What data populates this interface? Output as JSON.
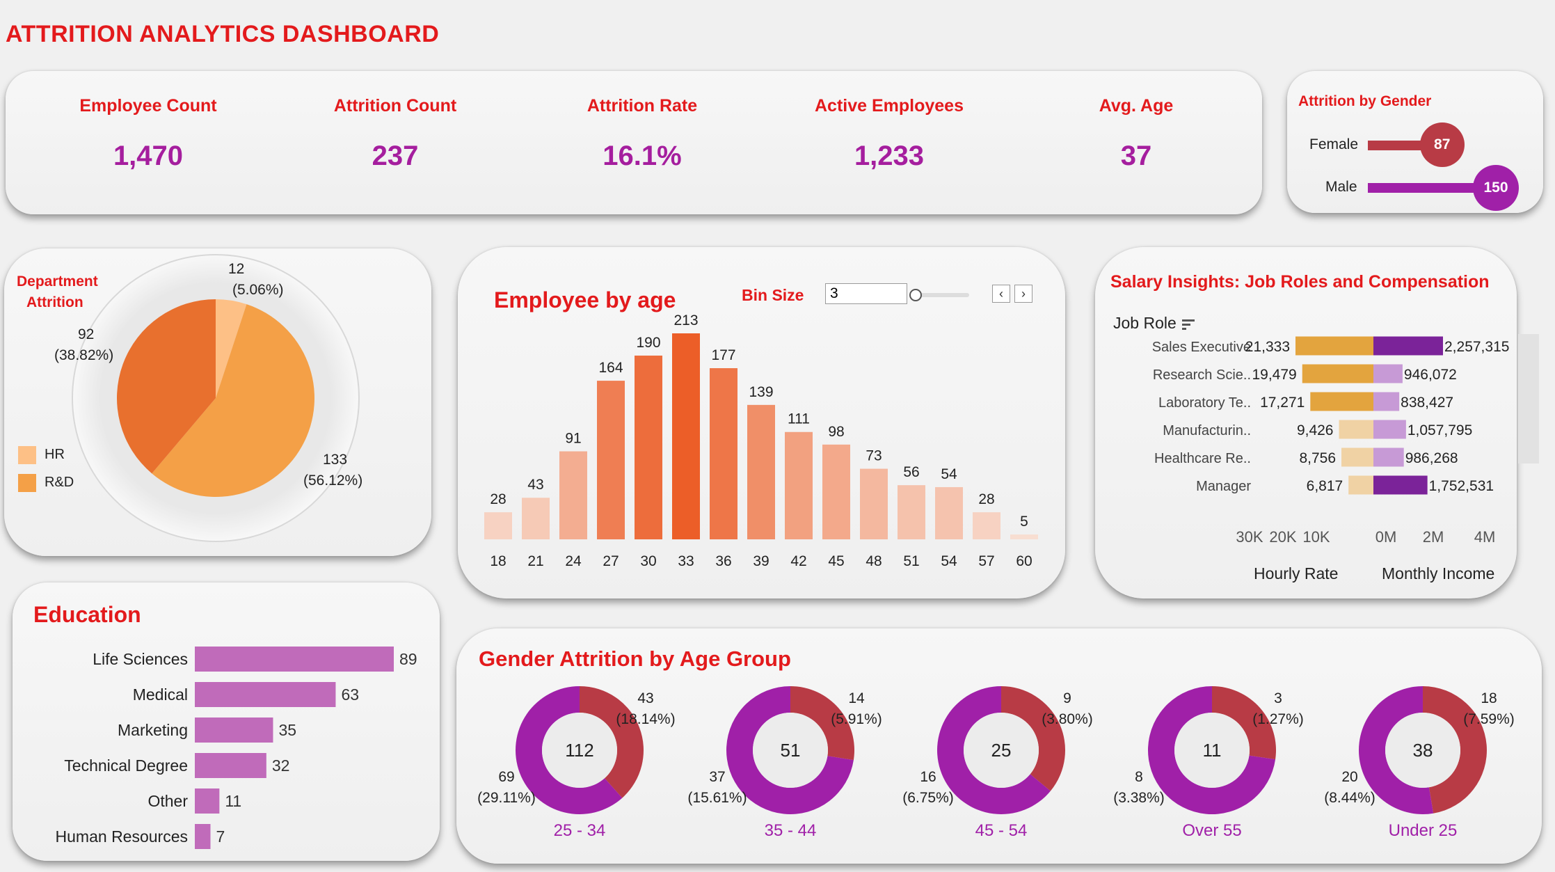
{
  "header": {
    "title": "ATTRITION ANALYTICS DASHBOARD"
  },
  "colors": {
    "accent_red": "#e31a1c",
    "kpi_purple": "#a51e9e",
    "female_red": "#b83b45",
    "male_purple": "#a020a8",
    "hr_color": "#fdc086",
    "rd_color": "#f4a047",
    "rd_dark": "#e8702e",
    "education_bar": "#c06bba"
  },
  "kpis": [
    {
      "label": "Employee Count",
      "value": "1,470"
    },
    {
      "label": "Attrition Count",
      "value": "237"
    },
    {
      "label": "Attrition Rate",
      "value": "16.1%"
    },
    {
      "label": "Active Employees",
      "value": "1,233"
    },
    {
      "label": "Avg. Age",
      "value": "37"
    }
  ],
  "gender_panel": {
    "title": "Attrition by Gender",
    "items": [
      {
        "label": "Female",
        "value": 87,
        "value_text": "87"
      },
      {
        "label": "Male",
        "value": 150,
        "value_text": "150"
      }
    ]
  },
  "department_panel": {
    "title_line1": "Department",
    "title_line2": "Attrition",
    "legend": [
      "HR",
      "R&D"
    ],
    "labels": {
      "hr_count": "12",
      "hr_pct": "(5.06%)",
      "rd_count": "133",
      "rd_pct": "(56.12%)",
      "other_count": "92",
      "other_pct": "(38.82%)"
    }
  },
  "age_panel": {
    "title": "Employee by age",
    "bin_label": "Bin Size",
    "bin_value": "3",
    "prev_icon": "chevron-left-icon",
    "next_icon": "chevron-right-icon"
  },
  "salary_panel": {
    "title": "Salary Insights: Job Roles and Compensation",
    "job_role_header": "Job Role",
    "sort_icon": "sort-icon",
    "hourly_label": "Hourly Rate",
    "monthly_label": "Monthly Income",
    "hourly_ticks": [
      "30K",
      "20K",
      "10K"
    ],
    "monthly_ticks": [
      "0M",
      "2M",
      "4M"
    ],
    "rows": [
      {
        "role": "Sales Executive",
        "hourly": 21333,
        "hourly_text": "21,333",
        "monthly": 2257315,
        "monthly_text": "2,257,315"
      },
      {
        "role": "Research Scie..",
        "hourly": 19479,
        "hourly_text": "19,479",
        "monthly": 946072,
        "monthly_text": "946,072"
      },
      {
        "role": "Laboratory Te..",
        "hourly": 17271,
        "hourly_text": "17,271",
        "monthly": 838427,
        "monthly_text": "838,427"
      },
      {
        "role": "Manufacturin..",
        "hourly": 9426,
        "hourly_text": "9,426",
        "monthly": 1057795,
        "monthly_text": "1,057,795"
      },
      {
        "role": "Healthcare Re..",
        "hourly": 8756,
        "hourly_text": "8,756",
        "monthly": 986268,
        "monthly_text": "986,268"
      },
      {
        "role": "Manager",
        "hourly": 6817,
        "hourly_text": "6,817",
        "monthly": 1752531,
        "monthly_text": "1,752,531"
      }
    ]
  },
  "education_panel": {
    "title": "Education"
  },
  "gender_age_panel": {
    "title": "Gender Attrition by Age Group"
  },
  "chart_data": [
    {
      "type": "pie",
      "title": "Department Attrition",
      "categories": [
        "HR",
        "R&D",
        ""
      ],
      "values": [
        12,
        133,
        92
      ],
      "labels": [
        "12 (5.06%)",
        "133 (56.12%)",
        "92 (38.82%)"
      ]
    },
    {
      "type": "bar",
      "title": "Employee by age",
      "categories": [
        "18",
        "21",
        "24",
        "27",
        "30",
        "33",
        "36",
        "39",
        "42",
        "45",
        "48",
        "51",
        "54",
        "57",
        "60"
      ],
      "values": [
        28,
        43,
        91,
        164,
        190,
        213,
        177,
        139,
        111,
        98,
        73,
        56,
        54,
        28,
        5
      ]
    },
    {
      "type": "bar",
      "title": "Education",
      "orientation": "horizontal",
      "categories": [
        "Life Sciences",
        "Medical",
        "Marketing",
        "Technical Degree",
        "Other",
        "Human Resources"
      ],
      "values": [
        89,
        63,
        35,
        32,
        11,
        7
      ]
    },
    {
      "type": "pie",
      "title": "Gender Attrition by Age Group",
      "groups": [
        {
          "label": "25 - 34",
          "total": "112",
          "female": 43,
          "female_text": "43",
          "female_pct": "(18.14%)",
          "male": 69,
          "male_text": "69",
          "male_pct": "(29.11%)"
        },
        {
          "label": "35 - 44",
          "total": "51",
          "female": 14,
          "female_text": "14",
          "female_pct": "(5.91%)",
          "male": 37,
          "male_text": "37",
          "male_pct": "(15.61%)"
        },
        {
          "label": "45 - 54",
          "total": "25",
          "female": 9,
          "female_text": "9",
          "female_pct": "(3.80%)",
          "male": 16,
          "male_text": "16",
          "male_pct": "(6.75%)"
        },
        {
          "label": "Over 55",
          "total": "11",
          "female": 3,
          "female_text": "3",
          "female_pct": "(1.27%)",
          "male": 8,
          "male_text": "8",
          "male_pct": "(3.38%)"
        },
        {
          "label": "Under 25",
          "total": "38",
          "female": 18,
          "female_text": "18",
          "female_pct": "(7.59%)",
          "male": 20,
          "male_text": "20",
          "male_pct": "(8.44%)"
        }
      ]
    }
  ]
}
